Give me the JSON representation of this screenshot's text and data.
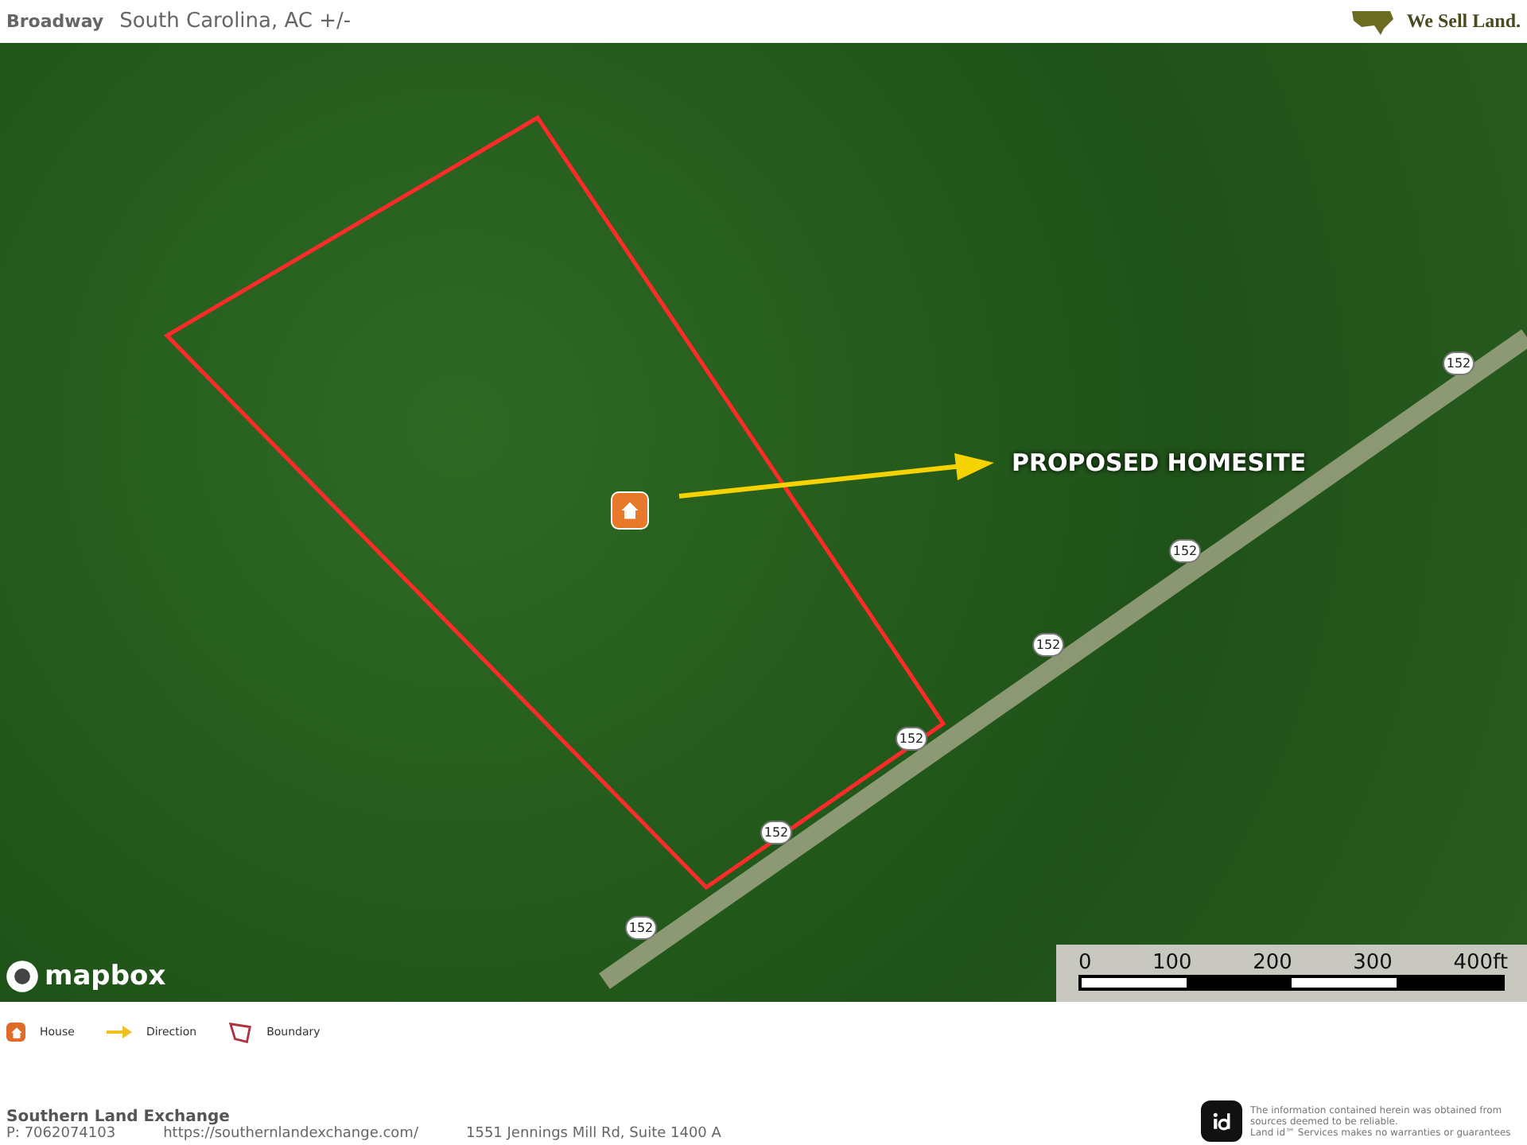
{
  "header": {
    "title": "Broadway",
    "subtitle": "South Carolina,  AC +/-",
    "logo_text": "We Sell Land."
  },
  "map": {
    "callout": "PROPOSED HOMESITE",
    "attribution": "mapbox",
    "road_labels": [
      "152",
      "152",
      "152",
      "152",
      "152",
      "152"
    ],
    "scale_ticks": [
      "0",
      "100",
      "200",
      "300",
      "400ft"
    ]
  },
  "legend": [
    {
      "kind": "house",
      "label": "House"
    },
    {
      "kind": "arrow",
      "label": "Direction"
    },
    {
      "kind": "boundary",
      "label": "Boundary"
    }
  ],
  "footer": {
    "company": "Southern Land Exchange",
    "phone": "P: 7062074103",
    "url": "https://southernlandexchange.com/",
    "address": "1551 Jennings Mill Rd, Suite 1400 A",
    "disclaimer": [
      "The information contained herein was obtained from sources deemed to be reliable.",
      "Land id™ Services makes no warranties or guarantees"
    ]
  }
}
